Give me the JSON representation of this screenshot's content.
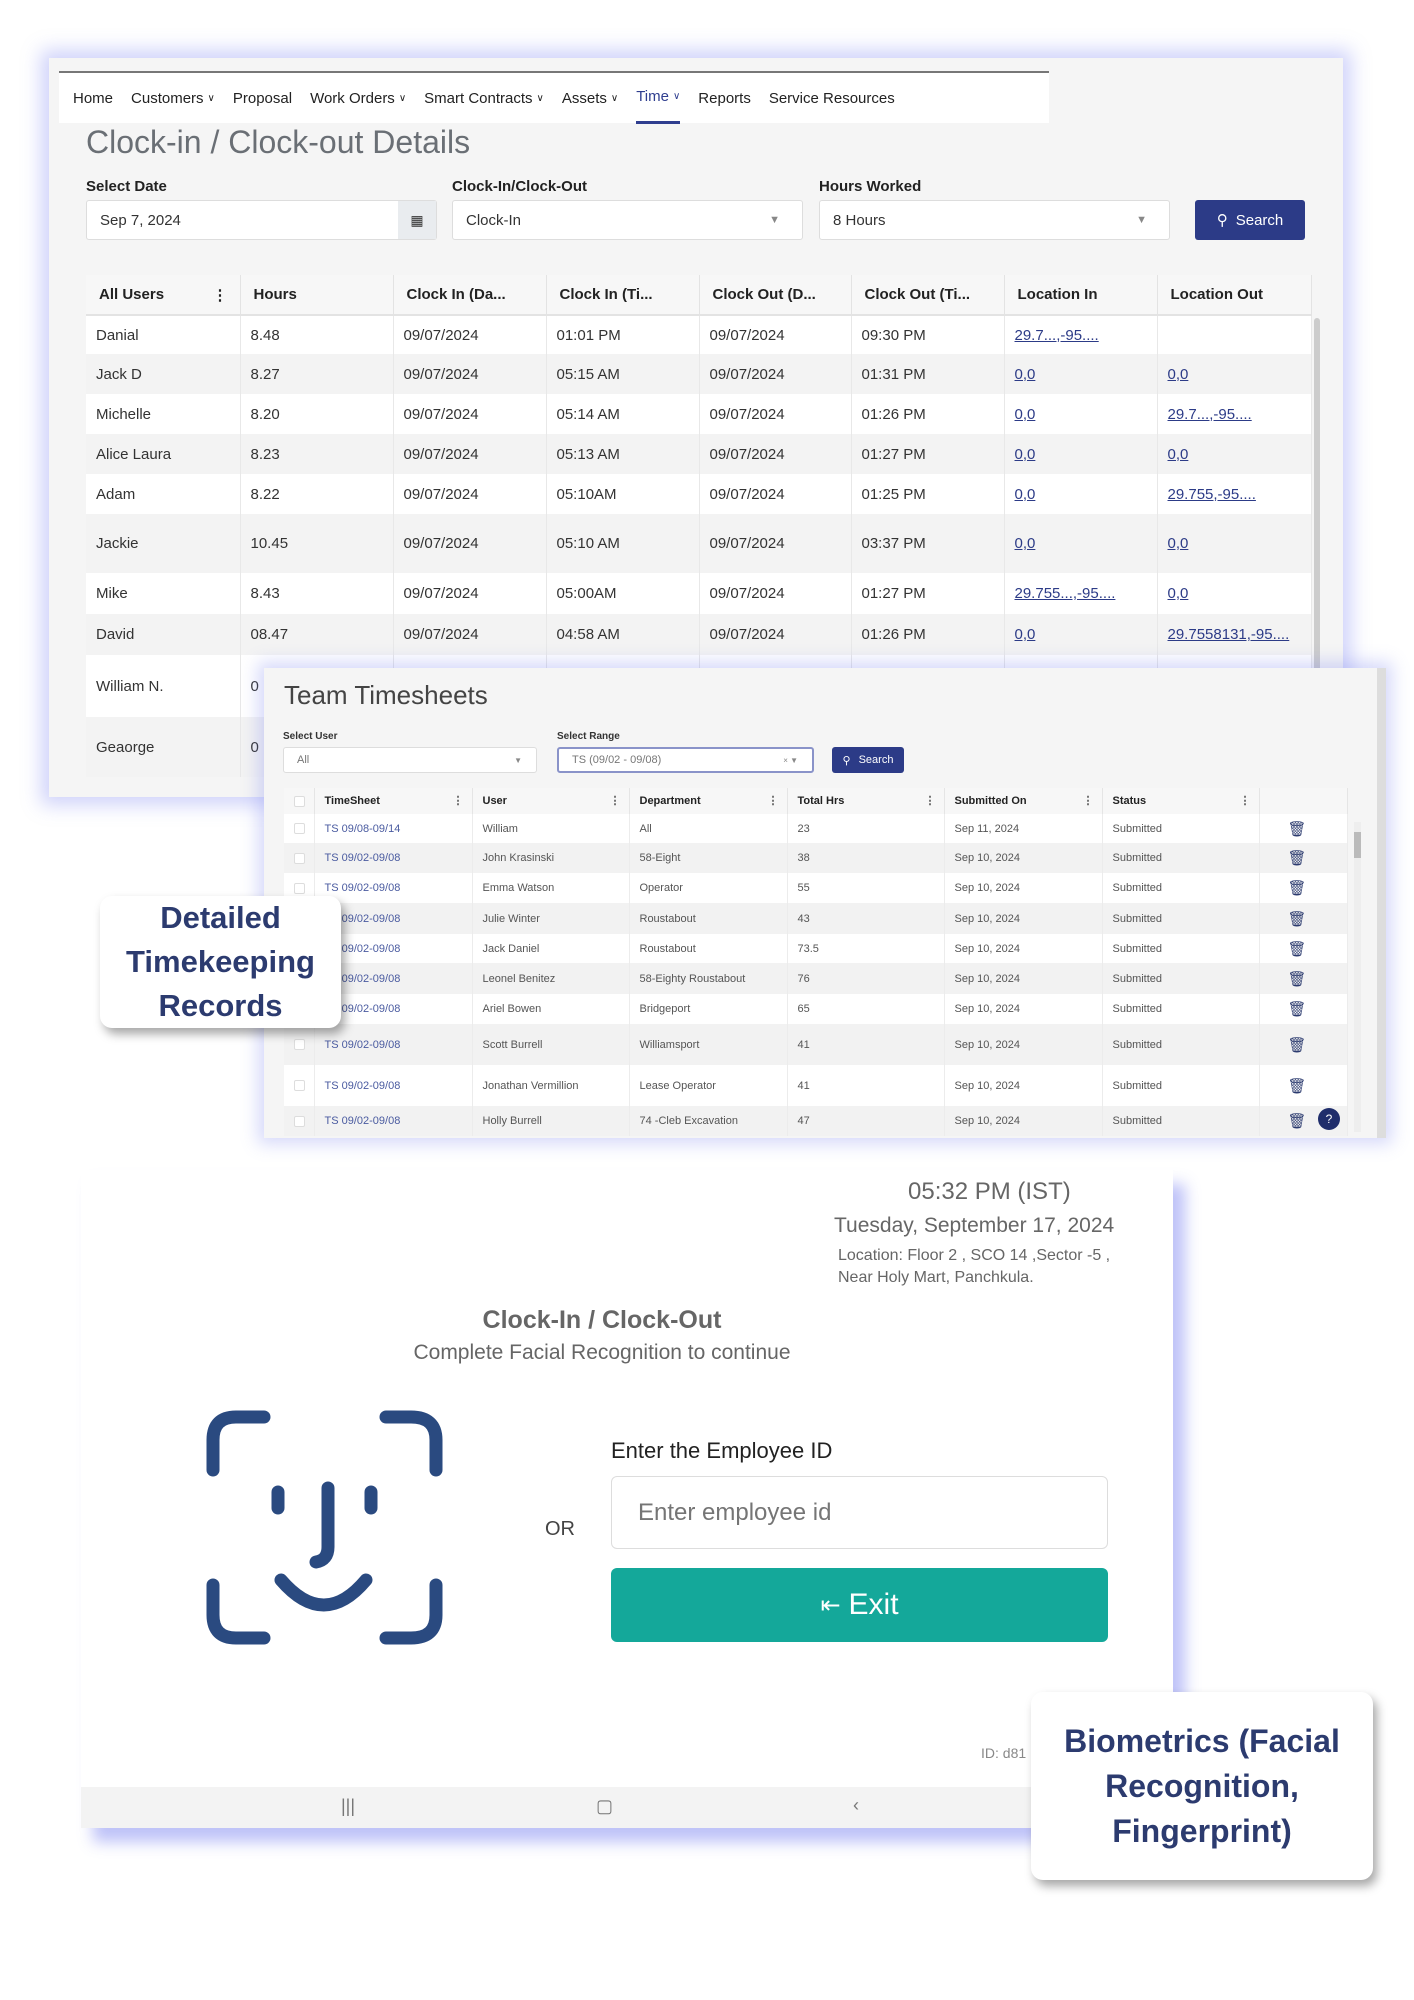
{
  "nav": {
    "items": [
      {
        "label": "Home",
        "dropdown": false
      },
      {
        "label": "Customers",
        "dropdown": true
      },
      {
        "label": "Proposal",
        "dropdown": false
      },
      {
        "label": "Work Orders",
        "dropdown": true
      },
      {
        "label": "Smart Contracts",
        "dropdown": true
      },
      {
        "label": "Assets",
        "dropdown": true
      },
      {
        "label": "Time",
        "dropdown": true,
        "active": true
      },
      {
        "label": "Reports",
        "dropdown": false
      },
      {
        "label": "Service Resources",
        "dropdown": false
      }
    ]
  },
  "clock_details": {
    "title": "Clock-in / Clock-out Details",
    "filters": {
      "date_label": "Select Date",
      "date_value": "Sep 7, 2024",
      "clock_label": "Clock-In/Clock-Out",
      "clock_value": "Clock-In",
      "hours_label": "Hours Worked",
      "hours_value": "8 Hours",
      "search_label": "Search"
    },
    "columns": [
      "All Users",
      "Hours",
      "Clock In (Da...",
      "Clock In (Ti...",
      "Clock Out (D...",
      "Clock Out (Ti...",
      "Location In",
      "Location Out"
    ],
    "rows": [
      [
        "Danial",
        "8.48",
        "09/07/2024",
        "01:01 PM",
        "09/07/2024",
        "09:30 PM",
        "29.7...,-95....",
        ""
      ],
      [
        "Jack D",
        "8.27",
        "09/07/2024",
        "05:15 AM",
        "09/07/2024",
        "01:31 PM",
        "0,0",
        "0,0"
      ],
      [
        "Michelle",
        "8.20",
        "09/07/2024",
        "05:14 AM",
        "09/07/2024",
        "01:26 PM",
        "0,0",
        "29.7...,-95...."
      ],
      [
        "Alice Laura",
        "8.23",
        "09/07/2024",
        "05:13 AM",
        "09/07/2024",
        "01:27 PM",
        "0,0",
        "0,0"
      ],
      [
        "Adam",
        "8.22",
        "09/07/2024",
        "05:10AM",
        "09/07/2024",
        "01:25 PM",
        "0,0",
        "29.755,-95...."
      ],
      [
        "Jackie",
        "10.45",
        "09/07/2024",
        "05:10 AM",
        "09/07/2024",
        "03:37 PM",
        "0,0",
        "0,0"
      ],
      [
        "Mike",
        "8.43",
        "09/07/2024",
        "05:00AM",
        "09/07/2024",
        "01:27 PM",
        "29.755...,-95....",
        "0,0"
      ],
      [
        "David",
        "08.47",
        "09/07/2024",
        "04:58 AM",
        "09/07/2024",
        "01:26 PM",
        "0,0",
        "29.7558131,-95...."
      ],
      [
        "William N.",
        "0",
        "",
        "",
        "",
        "",
        "",
        ""
      ],
      [
        "Geaorge",
        "0",
        "",
        "",
        "",
        "",
        "",
        ""
      ]
    ]
  },
  "team": {
    "title": "Team Timesheets",
    "user_label": "Select User",
    "user_value": "All",
    "range_label": "Select Range",
    "range_value": "TS (09/02 - 09/08)",
    "search_label": "Search",
    "columns": [
      "TimeSheet",
      "User",
      "Department",
      "Total Hrs",
      "Submitted On",
      "Status"
    ],
    "rows": [
      [
        "TS 09/08-09/14",
        "William",
        "All",
        "23",
        "Sep 11, 2024",
        "Submitted"
      ],
      [
        "TS 09/02-09/08",
        "John Krasinski",
        "58-Eight",
        "38",
        "Sep 10, 2024",
        "Submitted"
      ],
      [
        "TS 09/02-09/08",
        "Emma Watson",
        "Operator",
        "55",
        "Sep 10, 2024",
        "Submitted"
      ],
      [
        "TS 09/02-09/08",
        "Julie Winter",
        "Roustabout",
        "43",
        "Sep 10, 2024",
        "Submitted"
      ],
      [
        "TS 09/02-09/08",
        "Jack Daniel",
        "Roustabout",
        "73.5",
        "Sep 10, 2024",
        "Submitted"
      ],
      [
        "TS 09/02-09/08",
        "Leonel Benitez",
        "58-Eighty Roustabout",
        "76",
        "Sep 10, 2024",
        "Submitted"
      ],
      [
        "TS 09/02-09/08",
        "Ariel Bowen",
        "Bridgeport",
        "65",
        "Sep 10, 2024",
        "Submitted"
      ],
      [
        "TS 09/02-09/08",
        "Scott  Burrell",
        "Williamsport",
        "41",
        "Sep 10, 2024",
        "Submitted"
      ],
      [
        "TS 09/02-09/08",
        "Jonathan Vermillion",
        "Lease Operator",
        "41",
        "Sep 10, 2024",
        "Submitted"
      ],
      [
        "TS 09/02-09/08",
        "Holly Burrell",
        "74 -Cleb Excavation",
        "47",
        "Sep 10, 2024",
        "Submitted"
      ]
    ]
  },
  "badges": {
    "timekeeping": "Detailed Timekeeping Records",
    "biometrics": "Biometrics (Facial Recognition, Fingerprint)"
  },
  "kiosk": {
    "time": "05:32 PM (IST)",
    "date": "Tuesday, September 17, 2024",
    "location_line1": "Location: Floor 2 , SCO 14 ,Sector -5 ,",
    "location_line2": "Near Holy Mart, Panchkula.",
    "title": "Clock-In / Clock-Out",
    "subtitle": "Complete Facial Recognition to continue",
    "or": "OR",
    "id_label": "Enter the Employee ID",
    "id_placeholder": "Enter employee id",
    "exit_label": "Exit",
    "device_id": "ID: d81"
  },
  "colors": {
    "brand": "#2c3b87",
    "exit": "#14a89a",
    "face_icon": "#2a4a80"
  }
}
